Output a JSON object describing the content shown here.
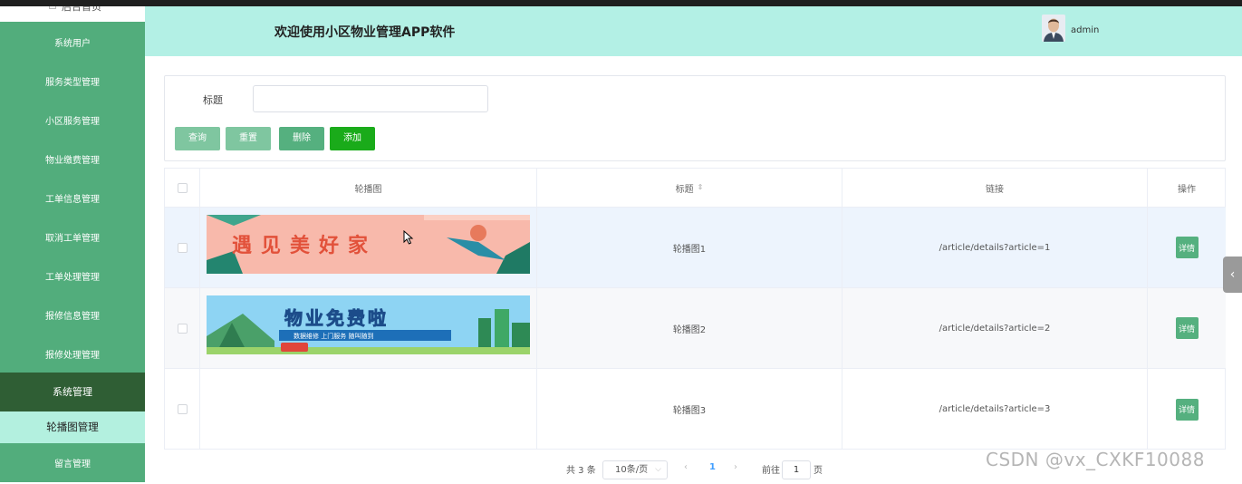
{
  "sidebar": {
    "top_item": "后台首页",
    "items": [
      {
        "label": "系统用户"
      },
      {
        "label": "服务类型管理"
      },
      {
        "label": "小区服务管理"
      },
      {
        "label": "物业缴费管理"
      },
      {
        "label": "工单信息管理"
      },
      {
        "label": "取消工单管理"
      },
      {
        "label": "工单处理管理"
      },
      {
        "label": "报修信息管理"
      },
      {
        "label": "报修处理管理"
      },
      {
        "label": "系统管理"
      },
      {
        "label": "轮播图管理"
      },
      {
        "label": "留言管理"
      }
    ]
  },
  "header": {
    "title": "欢迎使用小区物业管理APP软件",
    "username": "admin"
  },
  "search": {
    "label": "标题",
    "value": "",
    "placeholder": "",
    "buttons": {
      "query": "查询",
      "reset": "重置",
      "delete": "删除",
      "add": "添加"
    }
  },
  "table": {
    "columns": {
      "image": "轮播图",
      "title": "标题",
      "link": "链接",
      "action": "操作"
    },
    "rows": [
      {
        "banner_text": "遇见美好家",
        "title": "轮播图1",
        "link": "/article/details?article=1",
        "action": "详情"
      },
      {
        "banner_text": "物业免费啦",
        "banner_subtext": "数据维修 上门服务 随叫随到",
        "title": "轮播图2",
        "link": "/article/details?article=2",
        "action": "详情"
      },
      {
        "title": "轮播图3",
        "link": "/article/details?article=3",
        "action": "详情"
      }
    ]
  },
  "pagination": {
    "total": "共 3 条",
    "page_size": "10条/页",
    "current_page": "1",
    "goto_prefix": "前往",
    "goto_value": "1",
    "goto_suffix": "页"
  },
  "watermark": "CSDN @vx_CXKF10088",
  "colors": {
    "sidebar_bg": "#52ad7c",
    "sidebar_active": "#2f5e34",
    "header_bg": "#b3f0e5",
    "add_button": "#1aab1a"
  }
}
